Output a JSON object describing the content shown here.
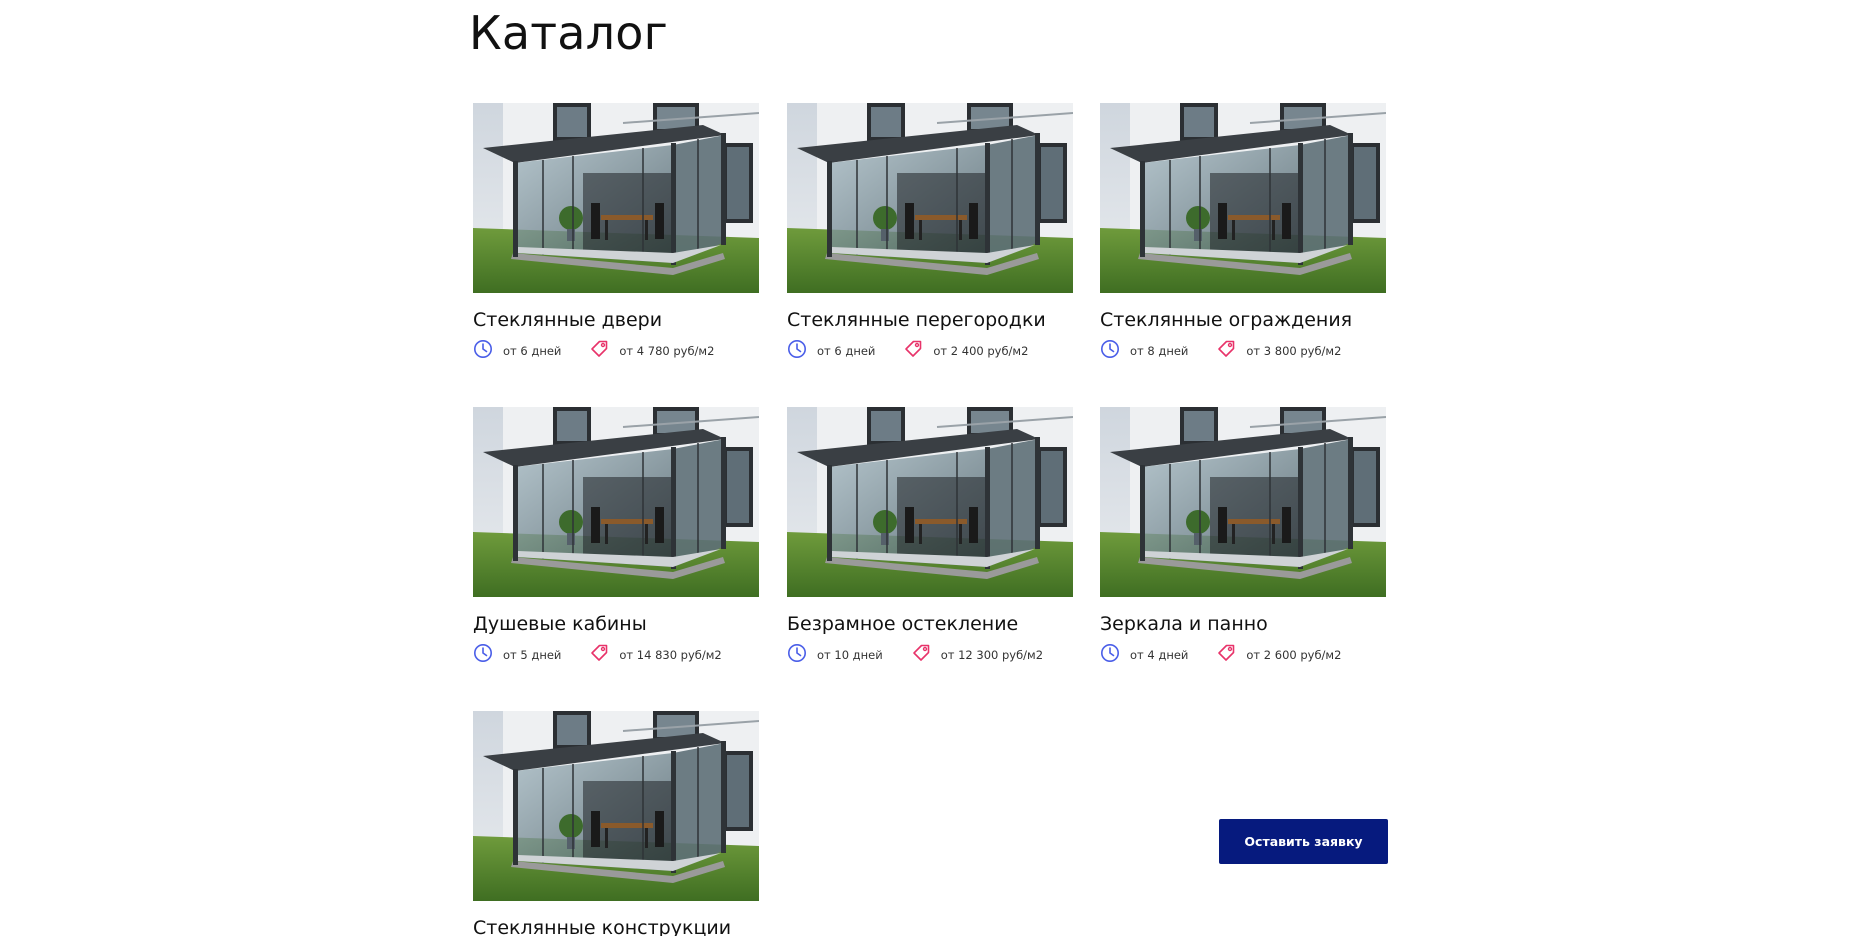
{
  "page": {
    "title": "Каталог"
  },
  "catalog": {
    "items": [
      {
        "name": "Стеклянные двери",
        "term": "от 6 дней",
        "price": "от 4 780 руб/м2"
      },
      {
        "name": "Стеклянные перегородки",
        "term": "от 6 дней",
        "price": "от 2 400 руб/м2"
      },
      {
        "name": "Стеклянные ограждения",
        "term": "от 8 дней",
        "price": "от 3 800 руб/м2"
      },
      {
        "name": "Душевые кабины",
        "term": "от 5 дней",
        "price": "от 14 830 руб/м2"
      },
      {
        "name": "Безрамное остекление",
        "term": "от 10 дней",
        "price": "от 12 300 руб/м2"
      },
      {
        "name": "Зеркала и панно",
        "term": "от 4 дней",
        "price": "от 2 600 руб/м2"
      },
      {
        "name": "Стеклянные конструкции"
      }
    ]
  },
  "cta": {
    "label": "Оставить заявку"
  },
  "icons": {
    "term": "clock-icon",
    "price": "price-tag-icon"
  },
  "colors": {
    "accent": "#061a7e",
    "clock_icon": "#4a5ee8",
    "tag_icon": "#e8336a"
  }
}
